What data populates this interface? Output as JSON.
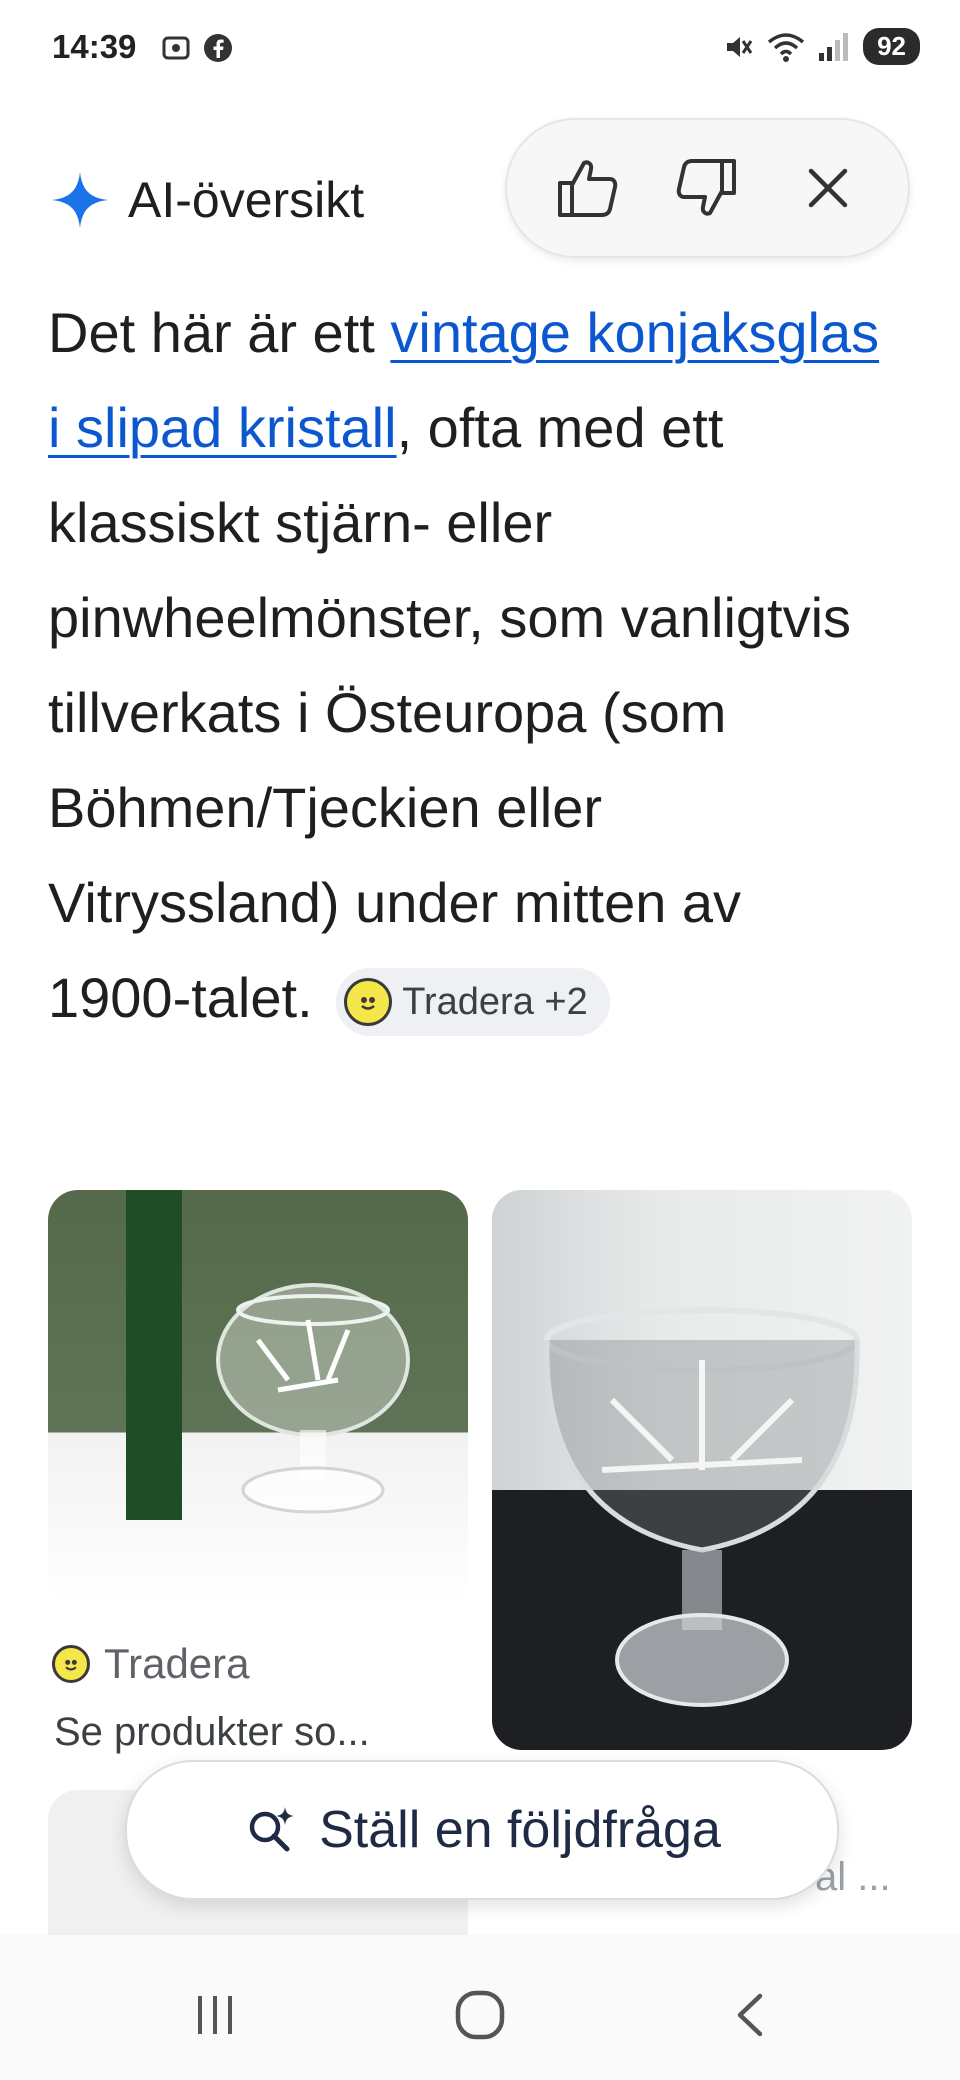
{
  "status_bar": {
    "time": "14:39",
    "battery": "92"
  },
  "ai_overview": {
    "title": "AI-översikt",
    "summary": {
      "prefix": "Det här är ett ",
      "link_text": "vintage konjaksglas i slipad kristall",
      "suffix": ", ofta med ett klassiskt stjärn- eller pinwheelmönster, som vanligtvis tillverkats i Östeuropa (som Böhmen/Tjeckien eller Vitryssland) under mitten av 1900-talet. "
    },
    "source_chip": "Tradera +2"
  },
  "feedback": {
    "thumbs_up": "thumbs-up-icon",
    "thumbs_down": "thumbs-down-icon",
    "close": "close-icon"
  },
  "cards": [
    {
      "source": "Tradera",
      "caption": "Se produkter so..."
    },
    {
      "caption": "al ..."
    }
  ],
  "followup": {
    "label": "Ställ en följdfråga"
  },
  "colors": {
    "link": "#0b57d0",
    "ai_star": "#1a73e8",
    "tradera_yellow": "#f4e64b"
  }
}
